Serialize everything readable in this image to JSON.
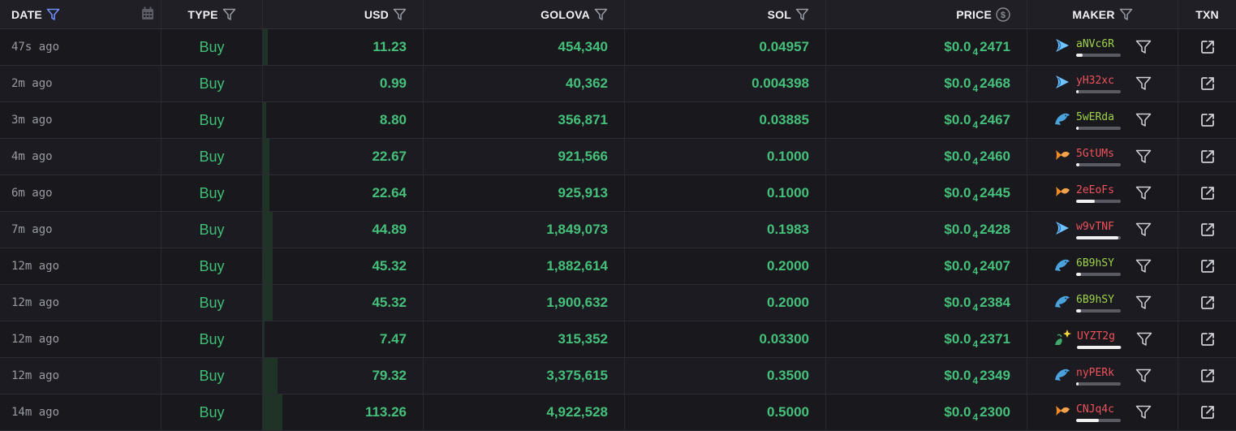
{
  "headers": {
    "date": "DATE",
    "type": "TYPE",
    "usd": "USD",
    "golova": "GOLOVA",
    "sol": "SOL",
    "price": "PRICE",
    "maker": "MAKER",
    "txn": "TXN"
  },
  "colors": {
    "buy": "#3fbf76",
    "value": "#45c07a",
    "maker_green": "#9fd24a",
    "maker_red": "#f0525c",
    "date_filter_active": "#6f8fff"
  },
  "rows": [
    {
      "date": "47s ago",
      "type": "Buy",
      "usd": "11.23",
      "golova": "454,340",
      "sol": "0.04957",
      "price_prefix": "$0.0",
      "price_sub": "4",
      "price_digits": "2471",
      "maker_icon": "shrimp-icon",
      "maker": "aNVc6R",
      "maker_color": "green",
      "maker_fill": 0.15,
      "usd_bar": 0.03
    },
    {
      "date": "2m ago",
      "type": "Buy",
      "usd": "0.99",
      "golova": "40,362",
      "sol": "0.004398",
      "price_prefix": "$0.0",
      "price_sub": "4",
      "price_digits": "2468",
      "maker_icon": "shrimp-icon",
      "maker": "yH32xc",
      "maker_color": "red",
      "maker_fill": 0.05,
      "usd_bar": 0.0
    },
    {
      "date": "3m ago",
      "type": "Buy",
      "usd": "8.80",
      "golova": "356,871",
      "sol": "0.03885",
      "price_prefix": "$0.0",
      "price_sub": "4",
      "price_digits": "2467",
      "maker_icon": "dolphin-icon",
      "maker": "5wERda",
      "maker_color": "green",
      "maker_fill": 0.05,
      "usd_bar": 0.02
    },
    {
      "date": "4m ago",
      "type": "Buy",
      "usd": "22.67",
      "golova": "921,566",
      "sol": "0.1000",
      "price_prefix": "$0.0",
      "price_sub": "4",
      "price_digits": "2460",
      "maker_icon": "fish-icon",
      "maker": "5GtUMs",
      "maker_color": "red",
      "maker_fill": 0.08,
      "usd_bar": 0.04
    },
    {
      "date": "6m ago",
      "type": "Buy",
      "usd": "22.64",
      "golova": "925,913",
      "sol": "0.1000",
      "price_prefix": "$0.0",
      "price_sub": "4",
      "price_digits": "2445",
      "maker_icon": "fish-icon",
      "maker": "2eEoFs",
      "maker_color": "red",
      "maker_fill": 0.42,
      "usd_bar": 0.04
    },
    {
      "date": "7m ago",
      "type": "Buy",
      "usd": "44.89",
      "golova": "1,849,073",
      "sol": "0.1983",
      "price_prefix": "$0.0",
      "price_sub": "4",
      "price_digits": "2428",
      "maker_icon": "shrimp-icon",
      "maker": "w9vTNF",
      "maker_color": "red",
      "maker_fill": 0.95,
      "usd_bar": 0.06
    },
    {
      "date": "12m ago",
      "type": "Buy",
      "usd": "45.32",
      "golova": "1,882,614",
      "sol": "0.2000",
      "price_prefix": "$0.0",
      "price_sub": "4",
      "price_digits": "2407",
      "maker_icon": "dolphin-icon",
      "maker": "6B9hSY",
      "maker_color": "green",
      "maker_fill": 0.1,
      "usd_bar": 0.06
    },
    {
      "date": "12m ago",
      "type": "Buy",
      "usd": "45.32",
      "golova": "1,900,632",
      "sol": "0.2000",
      "price_prefix": "$0.0",
      "price_sub": "4",
      "price_digits": "2384",
      "maker_icon": "dolphin-icon",
      "maker": "6B9hSY",
      "maker_color": "green",
      "maker_fill": 0.1,
      "usd_bar": 0.06
    },
    {
      "date": "12m ago",
      "type": "Buy",
      "usd": "7.47",
      "golova": "315,352",
      "sol": "0.03300",
      "price_prefix": "$0.0",
      "price_sub": "4",
      "price_digits": "2371",
      "maker_icon": "sparkle-icon",
      "maker": "UYZT2g",
      "maker_color": "red",
      "maker_fill": 0.98,
      "usd_bar": 0.01
    },
    {
      "date": "12m ago",
      "type": "Buy",
      "usd": "79.32",
      "golova": "3,375,615",
      "sol": "0.3500",
      "price_prefix": "$0.0",
      "price_sub": "4",
      "price_digits": "2349",
      "maker_icon": "dolphin-icon",
      "maker": "nyPERk",
      "maker_color": "red",
      "maker_fill": 0.05,
      "usd_bar": 0.09
    },
    {
      "date": "14m ago",
      "type": "Buy",
      "usd": "113.26",
      "golova": "4,922,528",
      "sol": "0.5000",
      "price_prefix": "$0.0",
      "price_sub": "4",
      "price_digits": "2300",
      "maker_icon": "fish-icon",
      "maker": "CNJq4c",
      "maker_color": "red",
      "maker_fill": 0.5,
      "usd_bar": 0.12
    }
  ]
}
